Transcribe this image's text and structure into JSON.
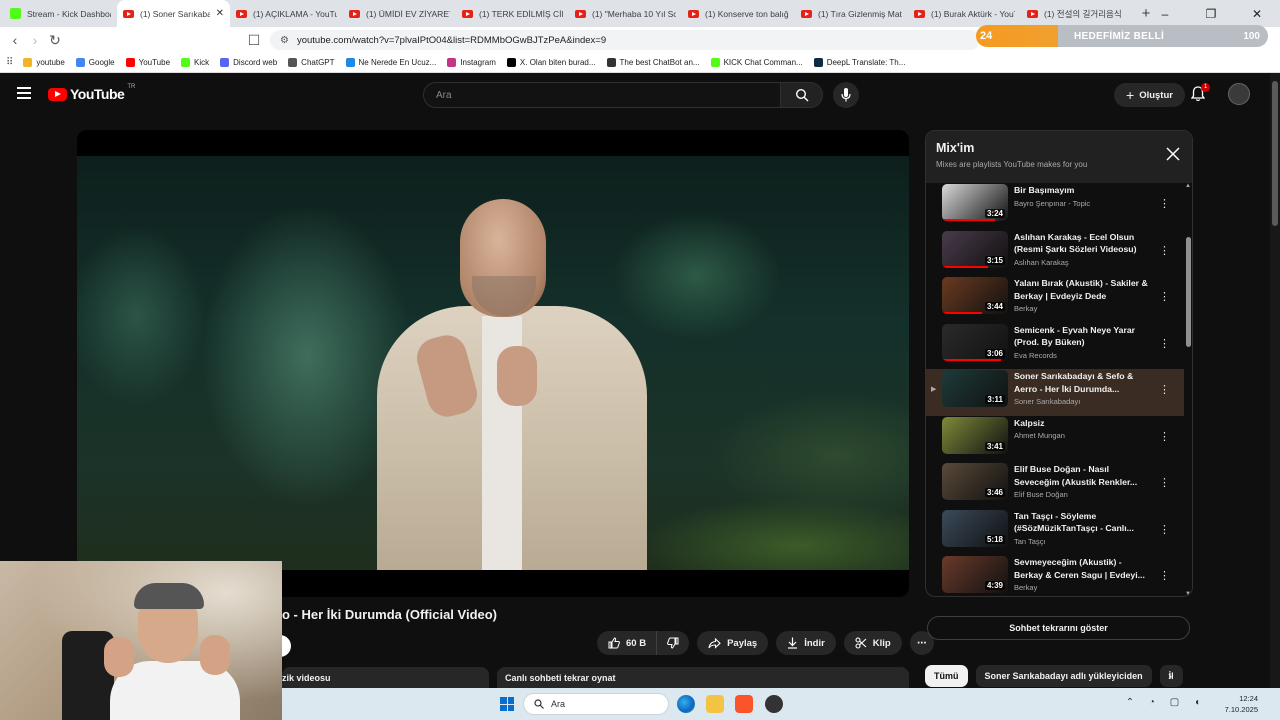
{
  "browser": {
    "tabs": [
      {
        "title": "Stream - Kick Dashboard",
        "icon": "kick"
      },
      {
        "title": "(1) Soner Sarıkabadayı",
        "icon": "youtube",
        "active": true
      },
      {
        "title": "(1) AÇIKLAMA - YouTube",
        "icon": "youtube"
      },
      {
        "title": "(1) ÜMİDİ EV ZİYARETİ",
        "icon": "youtube"
      },
      {
        "title": "(1) TERK EDİLMİŞ CİNCİ",
        "icon": "youtube"
      },
      {
        "title": "(1) \"Merhaba 10 Yıl Sonra",
        "icon": "youtube"
      },
      {
        "title": "(1) Konserve ton balığı",
        "icon": "youtube"
      },
      {
        "title": "(1) Tıra Gizlenmiş Mat",
        "icon": "youtube"
      },
      {
        "title": "(1) Burak Aktürk - YouTube",
        "icon": "youtube"
      },
      {
        "title": "(1) 전설의 길거리음식",
        "icon": "youtube"
      }
    ],
    "url": "youtube.com/watch?v=7plvaIPtO04&list=RDMMbOGwBJTzPeA&index=9",
    "bookmarks": [
      "youtube",
      "Google",
      "YouTube",
      "Kick",
      "Discord web",
      "ChatGPT",
      "Ne Nerede En Ucuz...",
      "Instagram",
      "X. Olan biten burad...",
      "The best ChatBot an...",
      "KICK Chat Comman...",
      "DeepL Translate: Th..."
    ],
    "goal_widget": {
      "level": "24",
      "label": "HEDEFİMİZ BELLİ",
      "count": "100",
      "progress": 0.28
    }
  },
  "youtube": {
    "region": "TR",
    "search_placeholder": "Ara",
    "create_label": "Oluştur",
    "notif_count": "1",
    "video_title": "o - Her İki Durumda (Official Video)",
    "likes": "60 B",
    "share": "Paylaş",
    "download": "İndir",
    "clip": "Klip",
    "desc_tab": "zik videosu",
    "chat_replay_tab": "Canlı sohbeti tekrar oynat",
    "show_chat": "Sohbet tekrarını göster",
    "chips": [
      "Tümü",
      "Soner Sarıkabadayı adlı yükleyiciden",
      "İl"
    ],
    "mix": {
      "title": "Mix'im",
      "subtitle": "Mixes are playlists YouTube makes for you",
      "items": [
        {
          "title": "Bir Başımayım",
          "channel": "Bayro Şenpınar - Topic",
          "duration": "3:24",
          "color": "#d9d9d9",
          "progress": 0.8
        },
        {
          "title": "Aslıhan Karakaş - Ecel Olsun (Resmi Şarkı Sözleri Videosu)",
          "channel": "Aslıhan Karakaş",
          "duration": "3:15",
          "color": "#4a3a4a",
          "progress": 0.7
        },
        {
          "title": "Yalanı Bırak (Akustik) - Sakiler & Berkay | Evdeyiz Dede",
          "channel": "Berkay",
          "duration": "3:44",
          "color": "#6b3a1f",
          "progress": 0.6
        },
        {
          "title": "Semicenk - Eyvah Neye Yarar (Prod. By Büken)",
          "channel": "Eva Records",
          "duration": "3:06",
          "color": "#2b2b2b",
          "progress": 0.9
        },
        {
          "title": "Soner Sarıkabadayı & Sefo & Aerro - Her İki Durumda...",
          "channel": "Soner Sarıkabadayı",
          "duration": "3:11",
          "color": "#1e3a3a",
          "progress": 0.0,
          "current": true
        },
        {
          "title": "Kalpsiz",
          "channel": "Ahmet Mungan",
          "duration": "3:41",
          "color": "#7f8a3a",
          "progress": 0.0
        },
        {
          "title": "Elif Buse Doğan - Nasıl Seveceğim (Akustik Renkler...",
          "channel": "Elif Buse Doğan",
          "duration": "3:46",
          "color": "#5a4a3a",
          "progress": 0.0
        },
        {
          "title": "Tan Taşçı - Söyleme (#SözMüzikTanTaşçı - Canlı...",
          "channel": "Tan Taşçı",
          "duration": "5:18",
          "color": "#3a4a5a",
          "progress": 0.0
        },
        {
          "title": "Sevmeyeceğim (Akustik) - Berkay & Ceren Sagu | Evdeyi...",
          "channel": "Berkay",
          "duration": "4:39",
          "color": "#6a3a2a",
          "progress": 0.0
        }
      ]
    }
  },
  "taskbar": {
    "search": "Ara",
    "time": "12:24",
    "date": "7.10.2025"
  }
}
